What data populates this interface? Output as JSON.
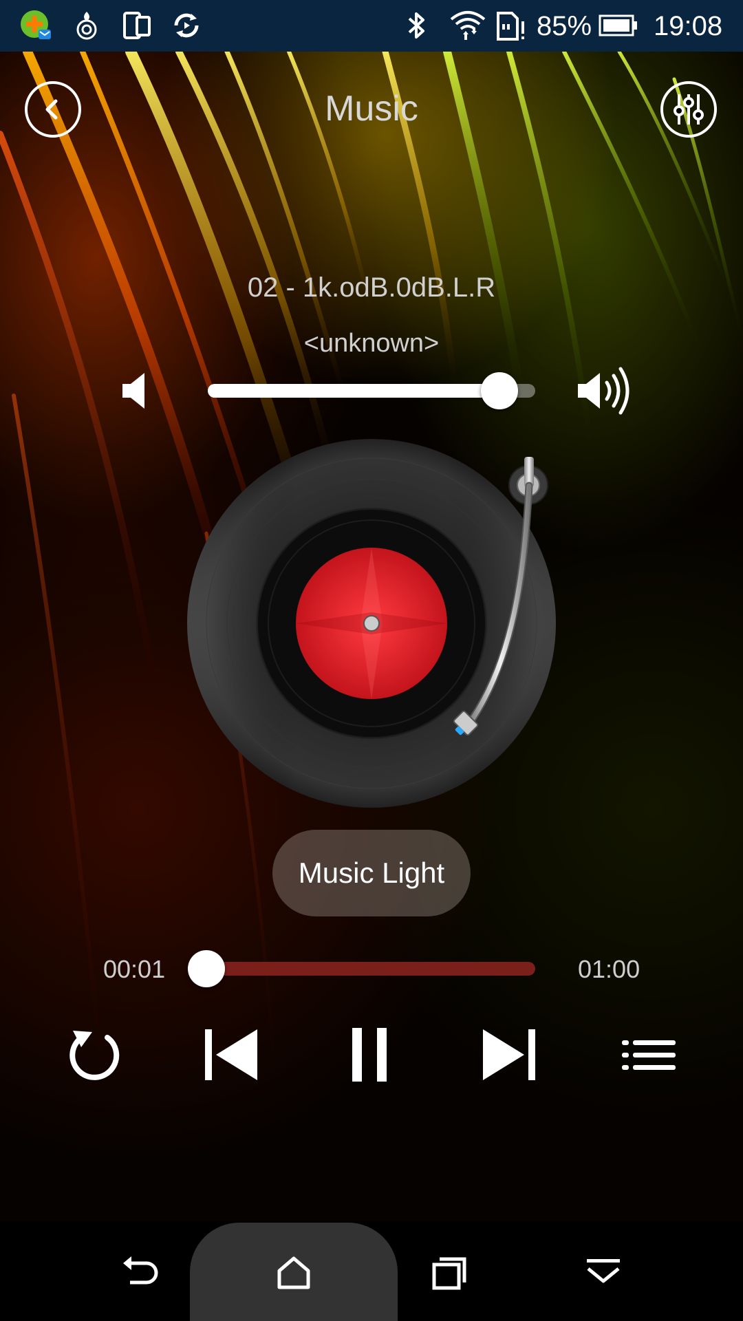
{
  "status_bar": {
    "battery_percent": "85%",
    "time": "19:08",
    "icons": [
      "app-notification-icon",
      "hotspot-icon",
      "screen-mirror-icon",
      "sync-icon",
      "bluetooth-icon",
      "wifi-icon",
      "sd-card-alert-icon",
      "battery-icon"
    ]
  },
  "header": {
    "title": "Music",
    "back_icon": "back-arrow-icon",
    "equalizer_icon": "equalizer-icon"
  },
  "track": {
    "title": "02 - 1k.odB.0dB.L.R",
    "artist": "<unknown>"
  },
  "volume": {
    "level": 0.89,
    "low_icon": "volume-low-icon",
    "high_icon": "volume-high-icon"
  },
  "turntable": {
    "label_color": "#d41c22"
  },
  "music_light_button": {
    "label": "Music Light"
  },
  "progress": {
    "current": "00:01",
    "total": "01:00",
    "fraction": 0.017
  },
  "controls": {
    "repeat_icon": "repeat-icon",
    "previous_icon": "skip-previous-icon",
    "play_pause_icon": "pause-icon",
    "next_icon": "skip-next-icon",
    "playlist_icon": "playlist-icon"
  },
  "navigation_bar": {
    "back_icon": "nav-back-icon",
    "home_icon": "nav-home-icon",
    "recents_icon": "nav-recents-icon",
    "hide_icon": "nav-hide-icon"
  },
  "colors": {
    "status_bar_bg": "#0a2540",
    "progress_track": "#7a1f1a",
    "record_label": "#d41c22"
  }
}
